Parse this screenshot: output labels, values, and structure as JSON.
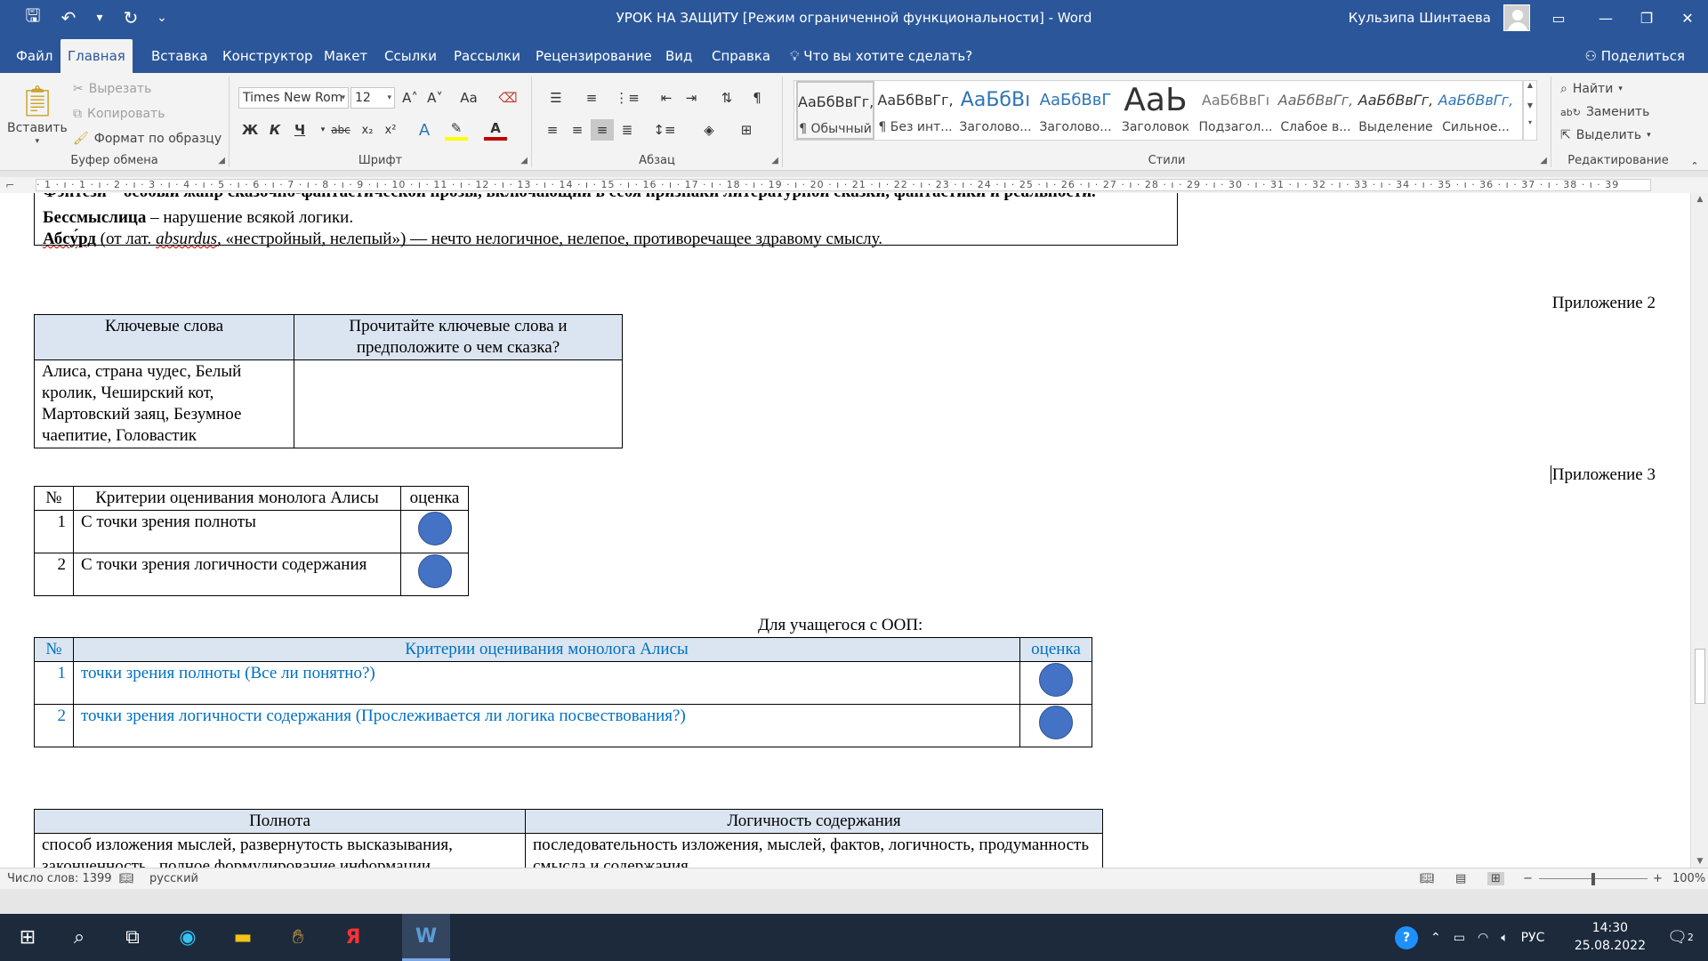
{
  "window": {
    "title": "УРОК НА ЗАЩИТУ [Режим ограниченной функциональности]  -  Word",
    "user": "Кульзипа Шинтаева"
  },
  "tabs": [
    "Файл",
    "Главная",
    "Вставка",
    "Конструктор",
    "Макет",
    "Ссылки",
    "Рассылки",
    "Рецензирование",
    "Вид",
    "Справка"
  ],
  "tell_me": "Что вы хотите сделать?",
  "share": "Поделиться",
  "clipboard": {
    "paste": "Вставить",
    "cut": "Вырезать",
    "copy": "Копировать",
    "format_painter": "Формат по образцу",
    "label": "Буфер обмена"
  },
  "font": {
    "name": "Times New Rom",
    "size": "12",
    "label": "Шрифт",
    "bold": "Ж",
    "italic": "К",
    "underline": "Ч",
    "strike": "abc",
    "sub": "x₂",
    "sup": "x²",
    "grow": "A˄",
    "shrink": "A˅",
    "case": "Aa"
  },
  "paragraph": {
    "label": "Абзац"
  },
  "styles": {
    "label": "Стили",
    "items": [
      {
        "preview": "АаБбВвГг,",
        "name": "¶ Обычный"
      },
      {
        "preview": "АаБбВвГг,",
        "name": "¶ Без инт..."
      },
      {
        "preview": "АаБбВı",
        "name": "Заголово..."
      },
      {
        "preview": "АаБбВвГ",
        "name": "Заголово..."
      },
      {
        "preview": "АаЬ",
        "name": "Заголовок"
      },
      {
        "preview": "АаБбВвГı",
        "name": "Подзагол..."
      },
      {
        "preview": "АаБбВвГг,",
        "name": "Слабое в..."
      },
      {
        "preview": "АаБбВвГг,",
        "name": "Выделение"
      },
      {
        "preview": "АаБбВвГг,",
        "name": "Сильное..."
      }
    ]
  },
  "editing": {
    "label": "Редактирование",
    "find": "Найти",
    "replace": "Заменить",
    "select": "Выделить"
  },
  "ruler_text": "· 1 · ı · 1 · ı · 2 · ı · 3 · ı · 4 · ı · 5 · ı · 6 · ı · 7 · ı · 8 · ı · 9 · ı · 10 · ı · 11 · ı · 12 · ı · 13 · ı · 14 · ı · 15 · ı · 16 · ı · 17 · ı · 18 · ı · 19 · ı · 20 · ı · 21 · ı · 22 · ı · 23 · ı · 24 · ı · 25 · ı · 26 · ı · 27 · ı · 28 · ı · 29 · ı · 30 · ı · 31 · ı · 32 · ı · 33 · ı · 34 · ı · 35 · ı · 36 · ı · 37 · ı · 38 · ı · 39",
  "document": {
    "top_cut": "Фэнтези – особый жанр сказочно-фантастической прозы, включающий в себя признаки литературной сказки, фантастики и реальности.",
    "bessmyslitsa_term": "Бессмыслица",
    "bessmyslitsa_def": " – нарушение всякой логики.",
    "absurd_term": "Абсу́рд",
    "absurd_def_1": " (от лат. ",
    "absurd_latin": "absurdus",
    "absurd_def_2": ", «нестройный, нелепый») — нечто нелогичное, нелепое, противоречащее здравому смыслу.",
    "appendix2": "Приложение 2",
    "keywords_table": {
      "h1": "Ключевые слова",
      "h2": "Прочитайте ключевые слова и предположите о чем сказка?",
      "c1": "Алиса, страна чудес, Белый кролик, Чеширский кот, Мартовский заяц, Безумное чаепитие, Головастик",
      "c2": ""
    },
    "appendix3": "Приложение 3",
    "criteria_table": {
      "h_num": "№",
      "h_crit": "Критерии оценивания монолога Алисы",
      "h_score": "оценка",
      "rows": [
        {
          "num": "1",
          "text": "С точки зрения полноты"
        },
        {
          "num": "2",
          "text": "С точки зрения логичности содержания"
        }
      ]
    },
    "oop_caption": "Для учащегося с ООП:",
    "oop_table": {
      "h_num": "№",
      "h_crit": "Критерии оценивания монолога Алисы",
      "h_score": "оценка",
      "rows": [
        {
          "num": "1",
          "text": "точки зрения полноты (Все ли понятно?)"
        },
        {
          "num": "2",
          "text": "точки зрения логичности содержания (Прослеживается ли логика посвествования?)"
        }
      ]
    },
    "bottom_table": {
      "h1": "Полнота",
      "h2": "Логичность содержания",
      "c1": "способ изложения мыслей, развернутость высказывания, законченность , полное формулирование информации",
      "c2": "последовательность изложения, мыслей, фактов, логичность, продуманность смысла и содержания"
    }
  },
  "status": {
    "words": "Число слов: 1399",
    "lang": "русский",
    "zoom": "100%"
  },
  "taskbar": {
    "lang": "РУС",
    "time": "14:30",
    "date": "25.08.2022",
    "notifications": "2"
  },
  "colors": {
    "word_blue": "#2b579a",
    "table_header": "#dbe5f1",
    "circle": "#4472c4",
    "oop_text": "#0070c0"
  }
}
